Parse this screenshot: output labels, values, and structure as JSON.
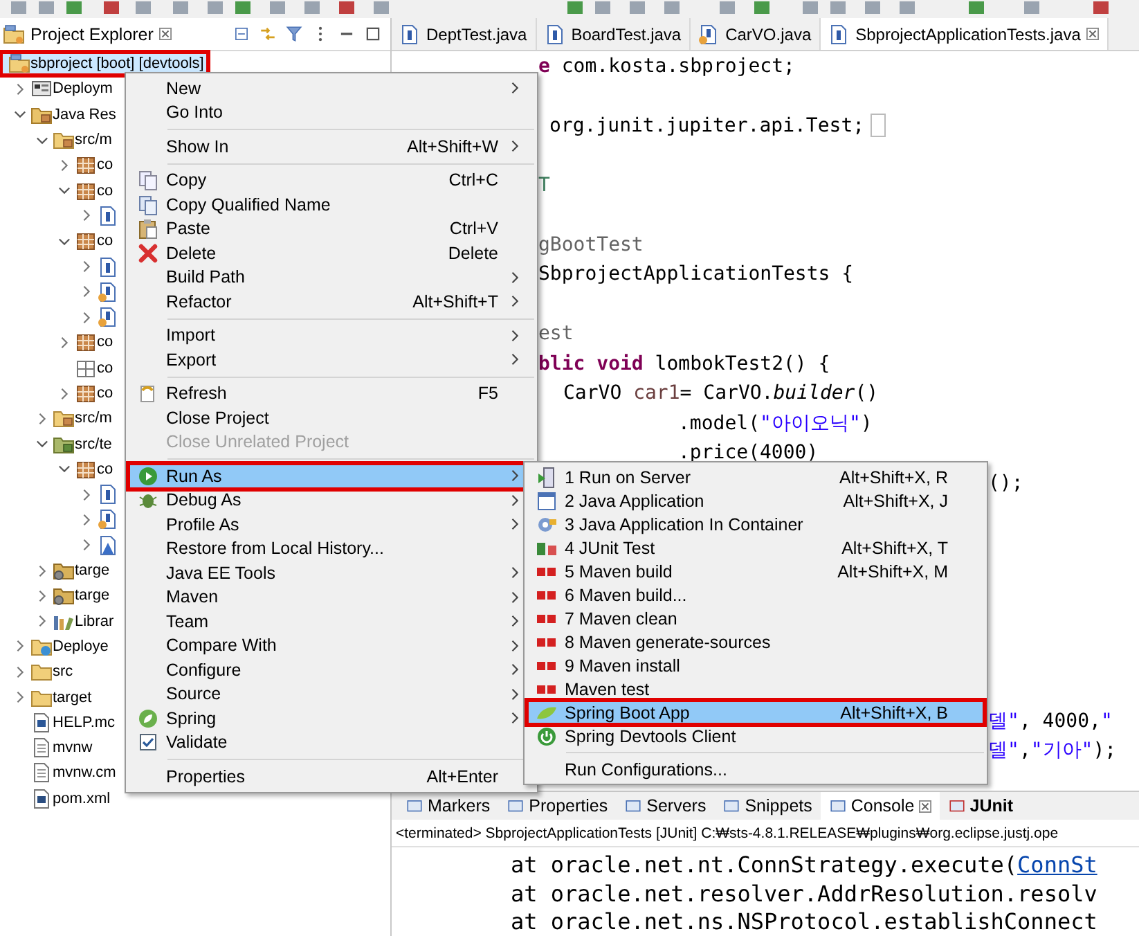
{
  "explorer": {
    "title": "Project Explorer"
  },
  "tree": [
    {
      "label": "sbproject [boot] [devtools]",
      "kind": "project",
      "selected": true,
      "outlined": true,
      "children": [
        {
          "label": "Deploym",
          "kind": "deployment",
          "expanded": false,
          "selected": false,
          "outlined": false
        },
        {
          "label": "Java Res",
          "kind": "java-resources",
          "expanded": true,
          "selected": false,
          "outlined": false,
          "children": [
            {
              "label": "src/m",
              "kind": "source-folder",
              "expanded": true,
              "selected": false,
              "outlined": false,
              "children": [
                {
                  "label": "co",
                  "kind": "package",
                  "expanded": false,
                  "selected": false,
                  "outlined": false
                },
                {
                  "label": "co",
                  "kind": "package",
                  "expanded": true,
                  "selected": false,
                  "outlined": false,
                  "children": [
                    {
                      "kind": "java-file",
                      "expanded": false,
                      "selected": false,
                      "outlined": false
                    }
                  ]
                },
                {
                  "label": "co",
                  "kind": "package",
                  "expanded": true,
                  "selected": false,
                  "outlined": false,
                  "children": [
                    {
                      "kind": "java-file",
                      "expanded": false,
                      "selected": false,
                      "outlined": false
                    },
                    {
                      "kind": "java-file-decorated",
                      "expanded": false,
                      "selected": false,
                      "outlined": false
                    },
                    {
                      "kind": "java-file-decorated",
                      "expanded": false,
                      "selected": false,
                      "outlined": false
                    }
                  ]
                },
                {
                  "label": "co",
                  "kind": "package",
                  "expanded": false,
                  "selected": false,
                  "outlined": false
                },
                {
                  "label": "co",
                  "kind": "empty-package",
                  "selected": false,
                  "outlined": false
                },
                {
                  "label": "co",
                  "kind": "package",
                  "expanded": false,
                  "selected": false,
                  "outlined": false
                }
              ]
            },
            {
              "label": "src/m",
              "kind": "source-folder",
              "expanded": false,
              "selected": false,
              "outlined": false
            },
            {
              "label": "src/te",
              "kind": "test-folder",
              "expanded": true,
              "selected": false,
              "outlined": false,
              "children": [
                {
                  "label": "co",
                  "kind": "package",
                  "expanded": true,
                  "selected": false,
                  "outlined": false,
                  "children": [
                    {
                      "kind": "java-file",
                      "expanded": false,
                      "selected": false,
                      "outlined": false
                    },
                    {
                      "kind": "java-file-decorated",
                      "expanded": false,
                      "selected": false,
                      "outlined": false
                    },
                    {
                      "kind": "java-test",
                      "expanded": false,
                      "selected": false,
                      "outlined": false
                    }
                  ]
                }
              ]
            },
            {
              "label": "targe",
              "kind": "target-folder",
              "expanded": false,
              "selected": false,
              "outlined": false
            },
            {
              "label": "targe",
              "kind": "target-folder",
              "expanded": false,
              "selected": false,
              "outlined": false
            },
            {
              "label": "Librar",
              "kind": "library",
              "expanded": false,
              "selected": false,
              "outlined": false
            }
          ]
        },
        {
          "label": "Deploye",
          "kind": "deployed-resources",
          "expanded": false,
          "selected": false,
          "outlined": false
        },
        {
          "label": "src",
          "kind": "folder",
          "expanded": false,
          "selected": false,
          "outlined": false
        },
        {
          "label": "target",
          "kind": "folder",
          "expanded": false,
          "selected": false,
          "outlined": false
        },
        {
          "label": "HELP.mc",
          "kind": "document",
          "selected": false,
          "outlined": false
        },
        {
          "label": "mvnw",
          "kind": "text-file",
          "selected": false,
          "outlined": false
        },
        {
          "label": "mvnw.cm",
          "kind": "text-file",
          "selected": false,
          "outlined": false
        },
        {
          "label": "pom.xml",
          "kind": "maven-file",
          "selected": false,
          "outlined": false
        }
      ]
    }
  ],
  "editor_tabs": [
    {
      "label": "DeptTest.java",
      "selected": false
    },
    {
      "label": "BoardTest.java",
      "selected": false
    },
    {
      "label": "CarVO.java",
      "selected": false
    },
    {
      "label": "SbprojectApplicationTests.java",
      "selected": true
    }
  ],
  "code_lines": [
    {
      "tokens": [
        {
          "kind": "keyword",
          "text": "e"
        },
        {
          "kind": "plain",
          "text": " com.kosta.sbproject;"
        }
      ]
    },
    {
      "tokens": [
        {
          "kind": "plain",
          "text": "org.junit.jupiter.api.Test;"
        }
      ],
      "folded": true
    },
    {
      "tokens": [
        {
          "kind": "comment",
          "text": "T"
        }
      ]
    },
    {
      "tokens": [
        {
          "kind": "annotation",
          "text": "gBootTest"
        }
      ]
    },
    {
      "tokens": [
        {
          "kind": "plain",
          "text": "SbprojectApplicationTests {"
        }
      ]
    },
    {
      "tokens": [
        {
          "kind": "annotation",
          "text": "est"
        }
      ]
    },
    {
      "tokens": [
        {
          "kind": "keyword",
          "text": "blic void"
        },
        {
          "kind": "plain",
          "text": " lombokTest2() {"
        }
      ]
    },
    {
      "tokens": [
        {
          "kind": "plain",
          "text": "CarVO "
        },
        {
          "kind": "local",
          "text": "car1"
        },
        {
          "kind": "plain",
          "text": "= CarVO."
        },
        {
          "kind": "static",
          "text": "builder"
        },
        {
          "kind": "plain",
          "text": "()"
        }
      ]
    },
    {
      "tokens": [
        {
          "kind": "plain",
          "text": ".model("
        },
        {
          "kind": "string",
          "text": "\"아이오닉\""
        },
        {
          "kind": "plain",
          "text": ")"
        }
      ]
    },
    {
      "tokens": [
        {
          "kind": "plain",
          "text": ".price(4000)"
        }
      ]
    },
    {
      "tokens": [
        {
          "kind": "plain",
          "text": "();"
        }
      ]
    },
    {
      "tokens": [
        {
          "kind": "string",
          "text": "델\""
        },
        {
          "kind": "plain",
          "text": ", 4000,"
        },
        {
          "kind": "string",
          "text": "\""
        }
      ]
    },
    {
      "tokens": [
        {
          "kind": "string",
          "text": "델\""
        },
        {
          "kind": "plain",
          "text": ","
        },
        {
          "kind": "string",
          "text": "\"기아\""
        },
        {
          "kind": "plain",
          "text": ");"
        }
      ]
    }
  ],
  "bottom_tabs": [
    {
      "label": "Markers",
      "selected": false,
      "bold": false
    },
    {
      "label": "Properties",
      "selected": false,
      "bold": false
    },
    {
      "label": "Servers",
      "selected": false,
      "bold": false
    },
    {
      "label": "Snippets",
      "selected": false,
      "bold": false
    },
    {
      "label": "Console",
      "selected": true,
      "bold": false
    },
    {
      "label": "JUnit",
      "selected": false,
      "bold": true
    }
  ],
  "console": {
    "title": "<terminated> SbprojectApplicationTests [JUnit] C:₩sts-4.8.1.RELEASE₩plugins₩org.eclipse.justj.ope",
    "lines": [
      {
        "text": "at oracle.net.nt.ConnStrategy.execute(",
        "link": "ConnSt"
      },
      {
        "text": "at oracle.net.resolver.AddrResolution.resolv"
      },
      {
        "text": "at oracle.net.ns.NSProtocol.establishConnect"
      }
    ]
  },
  "context_menu": {
    "groups": [
      [
        {
          "label": "New",
          "submenu": true,
          "selected": false,
          "disabled": false,
          "outlined": false
        },
        {
          "label": "Go Into",
          "submenu": false,
          "selected": false,
          "disabled": false,
          "outlined": false
        }
      ],
      [
        {
          "label": "Show In",
          "shortcut": "Alt+Shift+W",
          "submenu": true,
          "selected": false,
          "disabled": false,
          "outlined": false
        }
      ],
      [
        {
          "label": "Copy",
          "shortcut": "Ctrl+C",
          "submenu": false,
          "selected": false,
          "disabled": false,
          "outlined": false
        },
        {
          "label": "Copy Qualified Name",
          "submenu": false,
          "selected": false,
          "disabled": false,
          "outlined": false
        },
        {
          "label": "Paste",
          "shortcut": "Ctrl+V",
          "submenu": false,
          "selected": false,
          "disabled": false,
          "outlined": false
        },
        {
          "label": "Delete",
          "shortcut": "Delete",
          "submenu": false,
          "selected": false,
          "disabled": false,
          "outlined": false
        },
        {
          "label": "Build Path",
          "submenu": true,
          "selected": false,
          "disabled": false,
          "outlined": false
        },
        {
          "label": "Refactor",
          "shortcut": "Alt+Shift+T",
          "submenu": true,
          "selected": false,
          "disabled": false,
          "outlined": false
        }
      ],
      [
        {
          "label": "Import",
          "submenu": true,
          "selected": false,
          "disabled": false,
          "outlined": false
        },
        {
          "label": "Export",
          "submenu": true,
          "selected": false,
          "disabled": false,
          "outlined": false
        }
      ],
      [
        {
          "label": "Refresh",
          "shortcut": "F5",
          "submenu": false,
          "selected": false,
          "disabled": false,
          "outlined": false
        },
        {
          "label": "Close Project",
          "submenu": false,
          "selected": false,
          "disabled": false,
          "outlined": false
        },
        {
          "label": "Close Unrelated Project",
          "submenu": false,
          "selected": false,
          "disabled": true,
          "outlined": false
        }
      ],
      [
        {
          "label": "Run As",
          "submenu": true,
          "selected": true,
          "disabled": false,
          "outlined": true
        },
        {
          "label": "Debug As",
          "submenu": true,
          "selected": false,
          "disabled": false,
          "outlined": false
        },
        {
          "label": "Profile As",
          "submenu": true,
          "selected": false,
          "disabled": false,
          "outlined": false
        },
        {
          "label": "Restore from Local History...",
          "submenu": false,
          "selected": false,
          "disabled": false,
          "outlined": false
        },
        {
          "label": "Java EE Tools",
          "submenu": true,
          "selected": false,
          "disabled": false,
          "outlined": false
        },
        {
          "label": "Maven",
          "submenu": true,
          "selected": false,
          "disabled": false,
          "outlined": false
        },
        {
          "label": "Team",
          "submenu": true,
          "selected": false,
          "disabled": false,
          "outlined": false
        },
        {
          "label": "Compare With",
          "submenu": true,
          "selected": false,
          "disabled": false,
          "outlined": false
        },
        {
          "label": "Configure",
          "submenu": true,
          "selected": false,
          "disabled": false,
          "outlined": false
        },
        {
          "label": "Source",
          "submenu": true,
          "selected": false,
          "disabled": false,
          "outlined": false
        },
        {
          "label": "Spring",
          "submenu": true,
          "selected": false,
          "disabled": false,
          "outlined": false
        },
        {
          "label": "Validate",
          "submenu": false,
          "selected": false,
          "disabled": false,
          "outlined": false
        }
      ],
      [
        {
          "label": "Properties",
          "shortcut": "Alt+Enter",
          "submenu": false,
          "selected": false,
          "disabled": false,
          "outlined": false
        }
      ]
    ]
  },
  "run_as_menu": {
    "groups": [
      [
        {
          "label": "1 Run on Server",
          "shortcut": "Alt+Shift+X, R",
          "selected": false,
          "outlined": false
        },
        {
          "label": "2 Java Application",
          "shortcut": "Alt+Shift+X, J",
          "selected": false,
          "outlined": false
        },
        {
          "label": "3 Java Application In Container",
          "selected": false,
          "outlined": false
        },
        {
          "label": "4 JUnit Test",
          "shortcut": "Alt+Shift+X, T",
          "selected": false,
          "outlined": false
        },
        {
          "label": "5 Maven build",
          "shortcut": "Alt+Shift+X, M",
          "selected": false,
          "outlined": false
        },
        {
          "label": "6 Maven build...",
          "selected": false,
          "outlined": false
        },
        {
          "label": "7 Maven clean",
          "selected": false,
          "outlined": false
        },
        {
          "label": "8 Maven generate-sources",
          "selected": false,
          "outlined": false
        },
        {
          "label": "9 Maven install",
          "selected": false,
          "outlined": false
        },
        {
          "label": "Maven test",
          "selected": false,
          "outlined": false
        },
        {
          "label": "Spring Boot App",
          "shortcut": "Alt+Shift+X, B",
          "selected": true,
          "outlined": true
        },
        {
          "label": "Spring Devtools Client",
          "selected": false,
          "outlined": false
        }
      ],
      [
        {
          "label": "Run Configurations...",
          "selected": false,
          "outlined": false
        }
      ]
    ]
  }
}
